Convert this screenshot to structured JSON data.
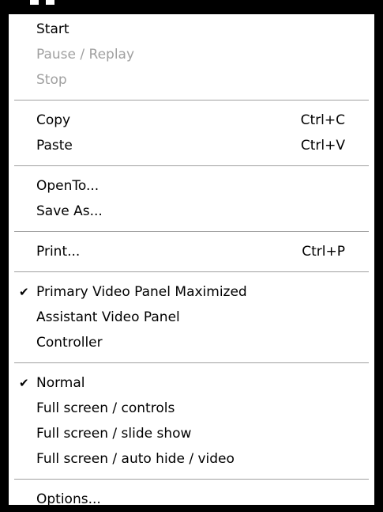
{
  "menu": {
    "groups": [
      {
        "items": [
          {
            "label": "Start",
            "shortcut": "",
            "disabled": false,
            "checked": false
          },
          {
            "label": "Pause / Replay",
            "shortcut": "",
            "disabled": true,
            "checked": false
          },
          {
            "label": "Stop",
            "shortcut": "",
            "disabled": true,
            "checked": false
          }
        ]
      },
      {
        "items": [
          {
            "label": "Copy",
            "shortcut": "Ctrl+C",
            "disabled": false,
            "checked": false
          },
          {
            "label": "Paste",
            "shortcut": "Ctrl+V",
            "disabled": false,
            "checked": false
          }
        ]
      },
      {
        "items": [
          {
            "label": "OpenTo...",
            "shortcut": "",
            "disabled": false,
            "checked": false
          },
          {
            "label": "Save As...",
            "shortcut": "",
            "disabled": false,
            "checked": false
          }
        ]
      },
      {
        "items": [
          {
            "label": "Print...",
            "shortcut": "Ctrl+P",
            "disabled": false,
            "checked": false
          }
        ]
      },
      {
        "items": [
          {
            "label": "Primary Video Panel Maximized",
            "shortcut": "",
            "disabled": false,
            "checked": true
          },
          {
            "label": "Assistant Video Panel",
            "shortcut": "",
            "disabled": false,
            "checked": false
          },
          {
            "label": "Controller",
            "shortcut": "",
            "disabled": false,
            "checked": false
          }
        ]
      },
      {
        "items": [
          {
            "label": "Normal",
            "shortcut": "",
            "disabled": false,
            "checked": true
          },
          {
            "label": "Full screen / controls",
            "shortcut": "",
            "disabled": false,
            "checked": false
          },
          {
            "label": "Full screen / slide show",
            "shortcut": "",
            "disabled": false,
            "checked": false
          },
          {
            "label": "Full screen / auto hide / video",
            "shortcut": "",
            "disabled": false,
            "checked": false
          }
        ]
      },
      {
        "items": [
          {
            "label": "Options...",
            "shortcut": "",
            "disabled": false,
            "checked": false
          }
        ]
      }
    ],
    "check_glyph": "✔",
    "colors": {
      "text": "#000000",
      "disabled_text": "#a0a0a0",
      "separator": "#a0a0a0",
      "background": "#ffffff"
    }
  }
}
